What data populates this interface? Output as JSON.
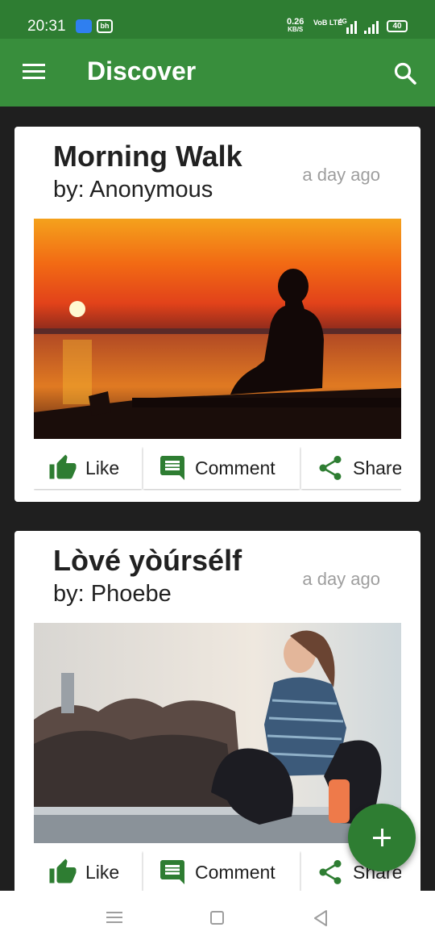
{
  "status_bar": {
    "time": "20:31",
    "app_icon_2": "bh",
    "net_speed": "0.26",
    "net_unit": "KB/S",
    "volte": "VoB LTE",
    "network": "4G",
    "battery": "40"
  },
  "app_bar": {
    "title": "Discover",
    "menu_icon": "menu-icon",
    "search_icon": "search-icon"
  },
  "posts": [
    {
      "title": "Morning Walk",
      "author": "by: Anonymous",
      "time": "a day ago",
      "image": "silhouette of woman sitting on pier at sunset"
    },
    {
      "title": "Lòvé yòúrsélf",
      "author": "by: Phoebe",
      "time": "a day ago",
      "image": "woman in sportswear sitting outdoors with earphones"
    }
  ],
  "actions": {
    "like": "Like",
    "comment": "Comment",
    "share": "Share"
  },
  "colors": {
    "primary": "#388e3c",
    "primary_dark": "#2e7d32",
    "icon_green": "#2e7d32",
    "background": "#1f1f1f"
  }
}
